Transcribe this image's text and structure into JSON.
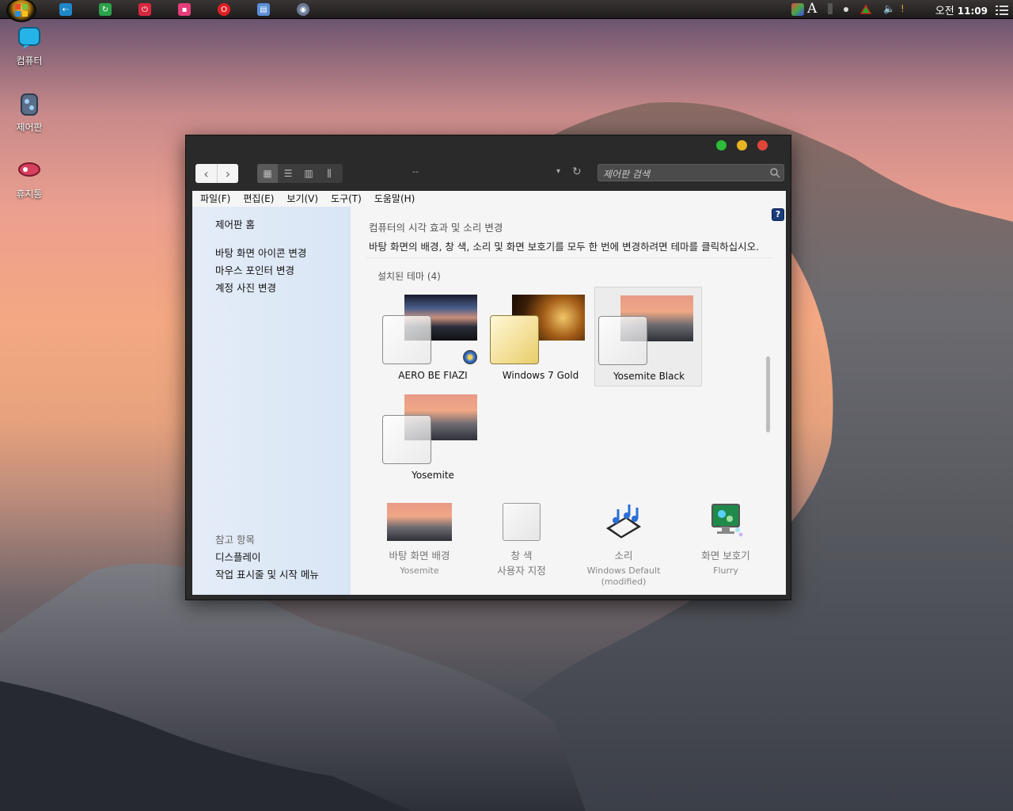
{
  "desktop": {
    "icons": [
      {
        "label": "컴퓨터",
        "icon": "computer-icon"
      },
      {
        "label": "제어판",
        "icon": "control-panel-icon"
      },
      {
        "label": "휴지통",
        "icon": "recycle-bin-icon"
      }
    ]
  },
  "taskbar": {
    "clock_period": "오전",
    "clock_time": "11:09",
    "tray_letter": "A"
  },
  "window": {
    "search_placeholder": "제어판 검색",
    "breadcrumb_sep": "--",
    "menu": [
      "파일(F)",
      "편집(E)",
      "보기(V)",
      "도구(T)",
      "도움말(H)"
    ],
    "left_pane": {
      "home": "제어판 홈",
      "links": [
        "바탕 화면 아이콘 변경",
        "마우스 포인터 변경",
        "계정 사진 변경"
      ],
      "see_also_title": "참고 항목",
      "see_also": [
        "디스플레이",
        "작업 표시줄 및 시작 메뉴"
      ]
    },
    "main": {
      "title": "컴퓨터의 시각 효과 및 소리 변경",
      "description": "바탕 화면의 배경, 창 색, 소리 및 화면 보호기를 모두 한 번에 변경하려면 테마를 클릭하십시오.",
      "themes_header": "설치된 테마 (4)",
      "themes": [
        {
          "name": "AERO BE FIAZI",
          "selected": false
        },
        {
          "name": "Windows 7 Gold",
          "selected": false
        },
        {
          "name": "Yosemite Black",
          "selected": true
        },
        {
          "name": "Yosemite",
          "selected": false
        }
      ],
      "bottom": [
        {
          "label": "바탕 화면 배경",
          "sub": "Yosemite"
        },
        {
          "label": "창 색",
          "sub": "사용자 지정"
        },
        {
          "label": "소리",
          "sub": "Windows Default (modified)"
        },
        {
          "label": "화면 보호기",
          "sub": "Flurry"
        }
      ]
    }
  },
  "colors": {
    "close": "#e0453a",
    "minimize": "#e8b421",
    "maximize": "#2dbb3a"
  }
}
